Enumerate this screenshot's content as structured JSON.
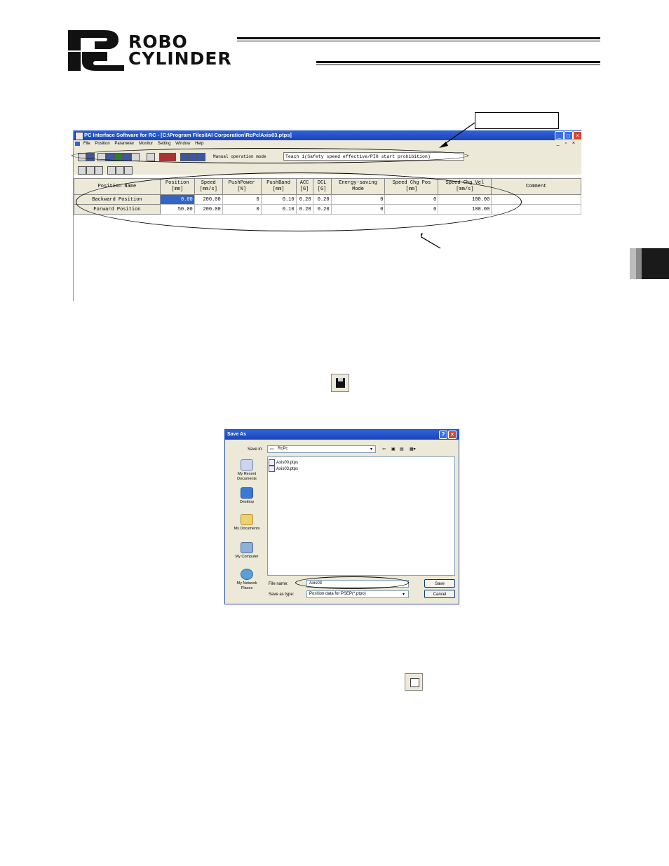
{
  "header": {
    "logo_line1": "ROBO",
    "logo_line2": "CYLINDER"
  },
  "app_window": {
    "title": "PC Interface Software for RC - [C:\\Program Files\\IAI Corporation\\RcPc\\Axis03.ptps]",
    "menu": [
      "File",
      "Position",
      "Parameter",
      "Monitor",
      "Setting",
      "Window",
      "Help"
    ],
    "mode_label": "Manual operation mode",
    "mode_value": "Teach 1(Safety speed effective/PIO start prohibition)",
    "columns": [
      {
        "line1": "Position Name",
        "line2": ""
      },
      {
        "line1": "Position",
        "line2": "[mm]"
      },
      {
        "line1": "Speed",
        "line2": "[mm/s]"
      },
      {
        "line1": "PushPower",
        "line2": "[%]"
      },
      {
        "line1": "PushBand",
        "line2": "[mm]"
      },
      {
        "line1": "ACC",
        "line2": "[G]"
      },
      {
        "line1": "DCL",
        "line2": "[G]"
      },
      {
        "line1": "Energy-saving",
        "line2": "Mode"
      },
      {
        "line1": "Speed Chg Pos",
        "line2": "[mm]"
      },
      {
        "line1": "Speed Chg Vel",
        "line2": "[mm/s]"
      },
      {
        "line1": "Comment",
        "line2": ""
      }
    ],
    "rows": [
      [
        "Backward Position",
        "0.00",
        "200.00",
        "0",
        "0.10",
        "0.20",
        "0.20",
        "0",
        "0",
        "100.00",
        ""
      ],
      [
        "Forward Position",
        "50.00",
        "200.00",
        "0",
        "0.10",
        "0.20",
        "0.20",
        "0",
        "0",
        "100.00",
        ""
      ]
    ]
  },
  "save_dialog": {
    "title": "Save As",
    "save_in_label": "Save in:",
    "save_in_value": "RcPc",
    "places": [
      "My Recent Documents",
      "Desktop",
      "My Documents",
      "My Computer",
      "My Network Places"
    ],
    "files": [
      "Axis00.ptps",
      "Axis03.ptps"
    ],
    "file_name_label": "File name:",
    "file_name_value": "Axis03",
    "save_type_label": "Save as type:",
    "save_type_value": "Position data for PSEP(*.ptpo)",
    "save_button": "Save",
    "cancel_button": "Cancel"
  },
  "colors": {
    "titlebar": "#1b45b8",
    "selected_cell": "#3465c4",
    "chrome": "#ece9d8"
  }
}
